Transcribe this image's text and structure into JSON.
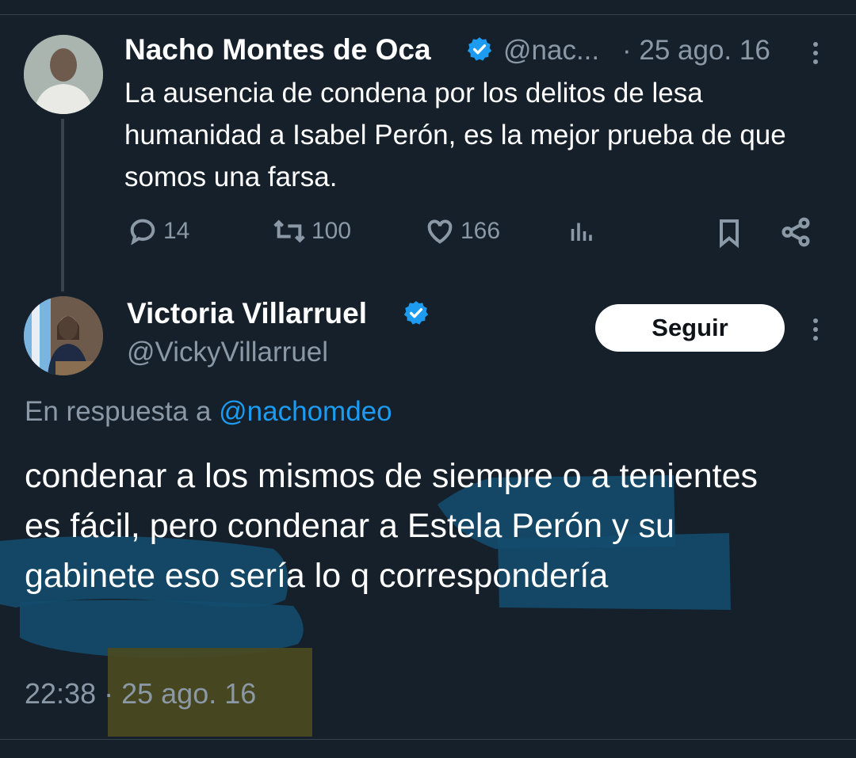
{
  "tweet1": {
    "author_name": "Nacho Montes de Oca",
    "author_handle": "@nac...",
    "date": "· 25 ago. 16",
    "text": "La ausencia de condena por los delitos de lesa humanidad a Isabel Perón, es la mejor prueba de que somos una farsa.",
    "replies": "14",
    "retweets": "100",
    "likes": "166"
  },
  "tweet2": {
    "author_name": "Victoria Villarruel",
    "author_handle": "@VickyVillarruel",
    "follow_label": "Seguir",
    "reply_prefix": "En respuesta a ",
    "reply_mention": "@nachomdeo",
    "text": "condenar a los mismos de siempre o a tenientes es fácil, pero condenar a Estela Perón y su gabinete eso sería lo q correspondería",
    "time": "22:38",
    "date": "· 25 ago. 16"
  },
  "colors": {
    "background": "#15202b",
    "text_secondary": "#8b98a5",
    "accent": "#1d9bf0",
    "highlight_blue": "#134b6b",
    "highlight_yellow": "#4b4a1f"
  }
}
